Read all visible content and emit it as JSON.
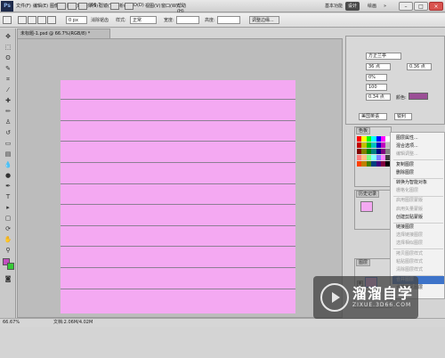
{
  "app": {
    "logo": "Ps"
  },
  "menubar": [
    "文件(F)",
    "编辑(E)",
    "图像(I)",
    "图层(L)",
    "选择(S)",
    "滤镜(T)",
    "分析(A)",
    "3D(D)",
    "视图(V)",
    "窗口(W)",
    "帮助(H)"
  ],
  "topbar": {
    "zoom": "66.7",
    "workspace_basic": "基本功能",
    "workspace_design": "设计",
    "workspace_paint": "绘画",
    "more": "»"
  },
  "options": {
    "feather_value": "0 px",
    "antialias_label": "消除锯齿",
    "style_label": "样式:",
    "style_value": "正常",
    "width_label": "宽度:",
    "height_label": "高度:",
    "refine_label": "调整边缘..."
  },
  "document": {
    "tab_title": "未标题-1.psd @ 66.7%(RGB/8) *",
    "status_zoom": "66.67%",
    "status_doc": "文档:2.06M/4.02M"
  },
  "character_panel": {
    "font_family": "方正兰亭",
    "font_size": "36 点",
    "leading": "0.36 点",
    "tracking": "0%",
    "kerning": "100",
    "baseline": "0.34 点",
    "color_label": "颜色:",
    "color": "#9b4f96",
    "language": "美国英语",
    "aa": "锐利"
  },
  "swatches_panel": {
    "tab": "色板"
  },
  "history_panel": {
    "tab": "历史记录"
  },
  "layers_panel": {
    "tab": "图层"
  },
  "context_menu": {
    "items": [
      {
        "label": "图层属性...",
        "disabled": false
      },
      {
        "label": "混合选项...",
        "disabled": false
      },
      {
        "label": "编辑调整...",
        "disabled": true
      },
      {
        "label": "复制图层",
        "disabled": false
      },
      {
        "label": "删除图层",
        "disabled": false
      },
      {
        "label": "转换为智能对象",
        "disabled": false
      },
      {
        "label": "栅格化图层",
        "disabled": true
      },
      {
        "label": "启用图层蒙版",
        "disabled": true
      },
      {
        "label": "启用矢量蒙版",
        "disabled": true
      },
      {
        "label": "创建剪贴蒙版",
        "disabled": false
      },
      {
        "label": "链接图层",
        "disabled": false
      },
      {
        "label": "选择链接图层",
        "disabled": true
      },
      {
        "label": "选择相似图层",
        "disabled": true
      },
      {
        "label": "拷贝图层样式",
        "disabled": true
      },
      {
        "label": "粘贴图层样式",
        "disabled": true
      },
      {
        "label": "清除图层样式",
        "disabled": true
      },
      {
        "label": "合并图层",
        "disabled": false
      },
      {
        "label": "合并可见图层",
        "disabled": false
      }
    ]
  },
  "watermark": {
    "title": "溜溜自学",
    "url": "ZIXUE.3D66.COM"
  },
  "colors": {
    "canvas": "#f4a9f2",
    "stripe": "#8d8094",
    "foreground": "#c24fc0",
    "background": "#36c936",
    "accent_selected": "#3d73c9"
  }
}
